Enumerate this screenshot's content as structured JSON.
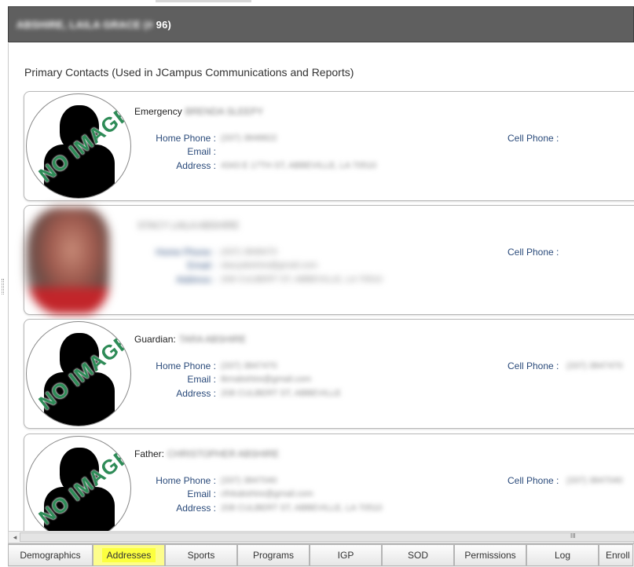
{
  "header": {
    "student_name": "ABSHIRE, LAILA GRACE (# ",
    "student_id_tail": "96)",
    "student_id_hidden": "     "
  },
  "section_title": "Primary Contacts (Used in JCampus Communications and Reports)",
  "labels": {
    "home_phone": "Home Phone :",
    "email": "Email :",
    "address": "Address :",
    "cell_phone": "Cell Phone :",
    "no_image": "NO IMAGE"
  },
  "contacts": [
    {
      "role": "Emergency",
      "name": "BRENDA SLEEPY",
      "home_phone": "(337) 3848822",
      "email": "",
      "address": "4343 E 17TH ST, ABBEVILLE, LA 70510",
      "cell_phone": ""
    },
    {
      "role": "",
      "name": "STACY LAILA ABSHIRE",
      "home_phone": "(337) 3848470",
      "email": "stacyabshire@gmail.com",
      "address": "208 CULBERT ST, ABBEVILLE, LA 70510",
      "cell_phone": "",
      "photo": "real"
    },
    {
      "role": "Guardian:",
      "name": "TARA ABSHIRE",
      "home_phone": "(337) 3847470",
      "email": "tkmabshire@gmail.com",
      "address": "208 CULBERT ST, ABBEVILLE",
      "cell_phone": "(337) 3847470"
    },
    {
      "role": "Father:",
      "name": "CHRISTOPHER ABSHIRE",
      "home_phone": "(337) 3847040",
      "email": "cfnkabshire@gmail.com",
      "address": "208 CULBERT ST, ABBEVILLE, LA 70510",
      "cell_phone": "(337) 3847040"
    }
  ],
  "scrollbar": {
    "left_arrow": "◂",
    "grip": "III"
  },
  "tabs": [
    {
      "label": "Demographics"
    },
    {
      "label": "Addresses",
      "active": true
    },
    {
      "label": "Sports"
    },
    {
      "label": "Programs"
    },
    {
      "label": "IGP"
    },
    {
      "label": "SOD"
    },
    {
      "label": "Permissions"
    },
    {
      "label": "Log"
    },
    {
      "label": "Enroll"
    }
  ],
  "colors": {
    "header_bg": "#5f5f5f",
    "label_blue": "#2a4a7a",
    "no_image_green": "#2e8b57",
    "active_tab": "#fcff3f"
  }
}
